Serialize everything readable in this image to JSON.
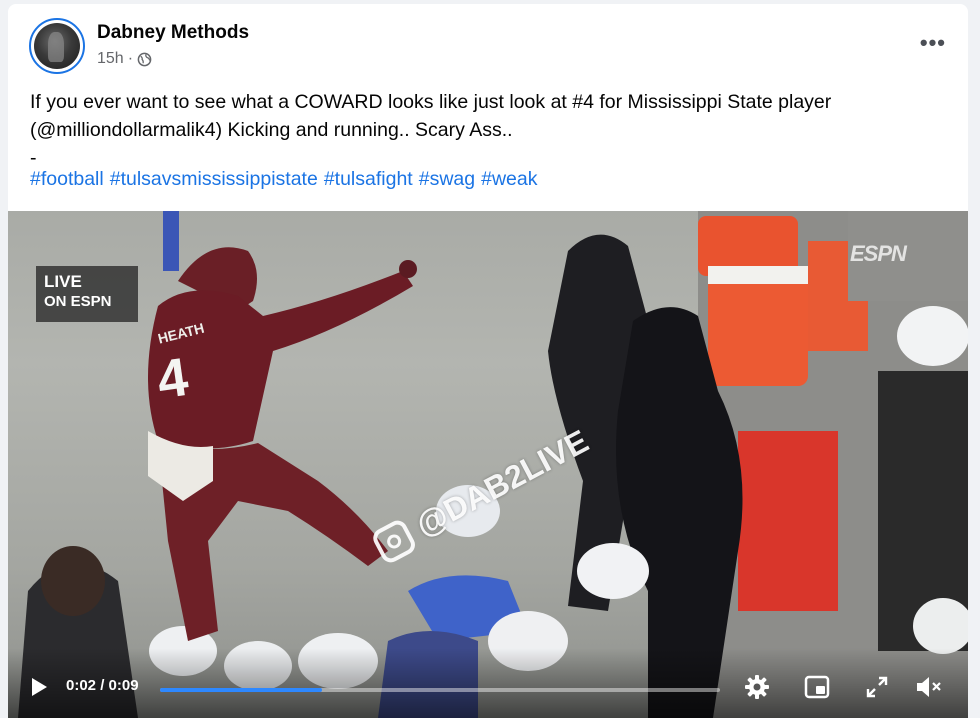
{
  "post": {
    "author": "Dabney Methods",
    "time": "15h",
    "separator": "·",
    "privacy_icon": "globe-icon",
    "more_label": "•••",
    "body_line1": "If you ever want to see what a COWARD looks like just look at #4 for Mississippi State player",
    "body_line2": "(@milliondollarmalik4) Kicking and running.. Scary Ass..",
    "body_line3": "-",
    "hashtags": [
      "#football",
      "#tulsavsmississippistate",
      "#tulsafight",
      "#swag",
      "#weak"
    ]
  },
  "video": {
    "live_line1": "LIVE",
    "live_line2": "ON ESPN",
    "network_logo": "ESPN",
    "watermark": "@DAB2LIVE",
    "jersey_name": "HEATH",
    "jersey_number": "4",
    "current_time": "0:02",
    "time_sep": "/",
    "duration": "0:09",
    "progress": 0.29,
    "accent_color": "#2d88ff",
    "icons": [
      "play-icon",
      "settings-gear-icon",
      "picture-in-picture-icon",
      "fullscreen-icon",
      "volume-muted-icon"
    ]
  }
}
